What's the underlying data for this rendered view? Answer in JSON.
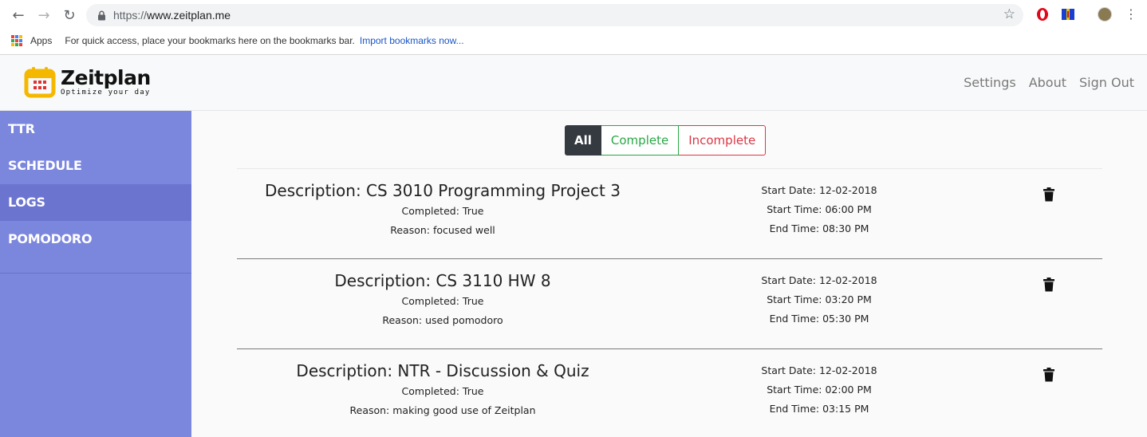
{
  "browser": {
    "url_scheme": "https://",
    "url_host": "www.zeitplan.me",
    "apps_label": "Apps",
    "bookmarks_tip": "For quick access, place your bookmarks here on the bookmarks bar.",
    "import_link": "Import bookmarks now..."
  },
  "app": {
    "brand": "Zeitplan",
    "tagline": "Optimize your day",
    "nav": [
      "Settings",
      "About",
      "Sign Out"
    ],
    "brand_color": "#f5b800",
    "sidebar_color": "#7b86dd"
  },
  "sidebar": {
    "items": [
      {
        "label": "TTR"
      },
      {
        "label": "SCHEDULE"
      },
      {
        "label": "LOGS",
        "active": true
      },
      {
        "label": "POMODORO"
      }
    ]
  },
  "filter": {
    "all": "All",
    "complete": "Complete",
    "incomplete": "Incomplete",
    "selected": "All"
  },
  "logs": [
    {
      "description": "Description: CS 3010 Programming Project 3",
      "completed": "Completed: True",
      "reason": "Reason: focused well",
      "start_date": "Start Date: 12-02-2018",
      "start_time": "Start Time: 06:00 PM",
      "end_time": "End Time: 08:30 PM"
    },
    {
      "description": "Description: CS 3110 HW 8",
      "completed": "Completed: True",
      "reason": "Reason: used pomodoro",
      "start_date": "Start Date: 12-02-2018",
      "start_time": "Start Time: 03:20 PM",
      "end_time": "End Time: 05:30 PM"
    },
    {
      "description": "Description: NTR - Discussion & Quiz",
      "completed": "Completed: True",
      "reason": "Reason: making good use of Zeitplan",
      "start_date": "Start Date: 12-02-2018",
      "start_time": "Start Time: 02:00 PM",
      "end_time": "End Time: 03:15 PM"
    }
  ]
}
